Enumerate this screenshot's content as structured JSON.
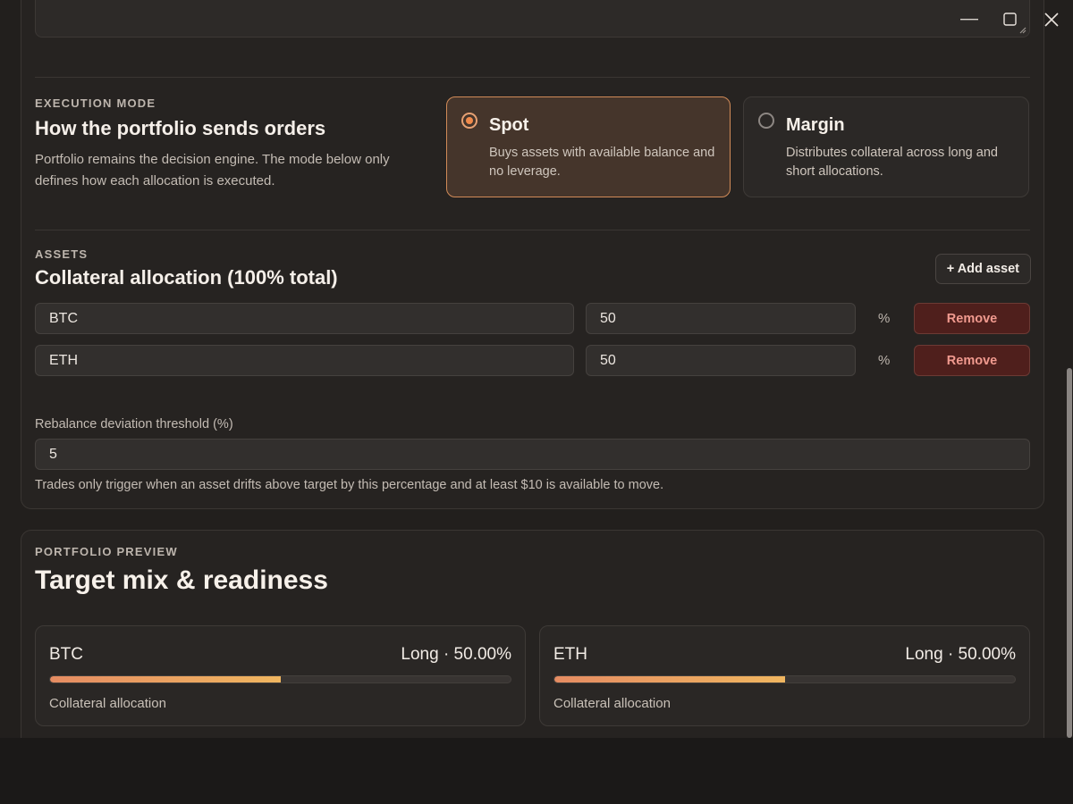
{
  "window": {
    "minimize_icon": "minimize-icon",
    "maximize_icon": "maximize-icon",
    "close_icon": "close-icon"
  },
  "execution": {
    "eyebrow": "EXECUTION MODE",
    "title": "How the portfolio sends orders",
    "description": "Portfolio remains the decision engine. The mode below only defines how each allocation is executed.",
    "modes": [
      {
        "title": "Spot",
        "description": "Buys assets with available balance and no leverage.",
        "selected": true
      },
      {
        "title": "Margin",
        "description": "Distributes collateral across long and short allocations.",
        "selected": false
      }
    ]
  },
  "assets": {
    "eyebrow": "ASSETS",
    "title": "Collateral allocation (100% total)",
    "add_label": "+ Add asset",
    "pct_sign": "%",
    "remove_label": "Remove",
    "rows": [
      {
        "symbol": "BTC",
        "percent": "50"
      },
      {
        "symbol": "ETH",
        "percent": "50"
      }
    ],
    "threshold_label": "Rebalance deviation threshold (%)",
    "threshold_value": "5",
    "threshold_help": "Trades only trigger when an asset drifts above target by this percentage and at least $10 is available to move."
  },
  "preview": {
    "eyebrow": "PORTFOLIO PREVIEW",
    "title": "Target mix & readiness",
    "items": [
      {
        "symbol": "BTC",
        "side": "Long · 50.00%",
        "fill_fraction": 0.5,
        "caption": "Collateral allocation"
      },
      {
        "symbol": "ETH",
        "side": "Long · 50.00%",
        "fill_fraction": 0.5,
        "caption": "Collateral allocation"
      }
    ]
  },
  "colors": {
    "accent": "#e7a173",
    "danger": "#f19a8f",
    "bar_start": "#e58c62",
    "bar_end": "#f0b660"
  }
}
